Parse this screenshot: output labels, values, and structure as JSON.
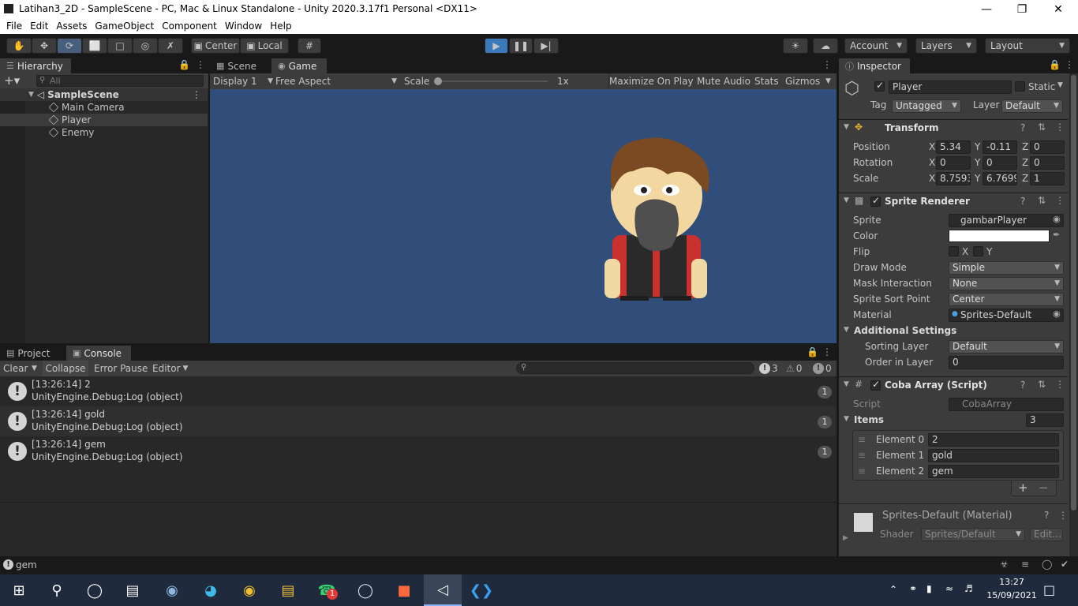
{
  "window": {
    "title": "Latihan3_2D - SampleScene - PC, Mac & Linux Standalone - Unity 2020.3.17f1 Personal <DX11>"
  },
  "menu": [
    "File",
    "Edit",
    "Assets",
    "GameObject",
    "Component",
    "Window",
    "Help"
  ],
  "toolbar": {
    "pivot": "Center",
    "space": "Local",
    "account": "Account",
    "layers": "Layers",
    "layout": "Layout"
  },
  "hierarchy": {
    "tab": "Hierarchy",
    "search_placeholder": "All",
    "scene": "SampleScene",
    "items": [
      "Main Camera",
      "Player",
      "Enemy"
    ]
  },
  "game": {
    "tabs": [
      "Scene",
      "Game"
    ],
    "display": "Display 1",
    "aspect": "Free Aspect",
    "scale_label": "Scale",
    "scale_value": "1x",
    "maximize": "Maximize On Play",
    "mute": "Mute Audio",
    "stats": "Stats",
    "gizmos": "Gizmos",
    "background": "#314d79"
  },
  "console": {
    "tabs": [
      "Project",
      "Console"
    ],
    "clear": "Clear",
    "collapse": "Collapse",
    "error_pause": "Error Pause",
    "editor": "Editor",
    "count_log": "3",
    "count_warn": "0",
    "count_err": "0",
    "logs": [
      {
        "line1": "[13:26:14] 2",
        "line2": "UnityEngine.Debug:Log (object)",
        "count": "1"
      },
      {
        "line1": "[13:26:14] gold",
        "line2": "UnityEngine.Debug:Log (object)",
        "count": "1"
      },
      {
        "line1": "[13:26:14] gem",
        "line2": "UnityEngine.Debug:Log (object)",
        "count": "1"
      }
    ]
  },
  "inspector": {
    "tab": "Inspector",
    "object_name": "Player",
    "static_label": "Static",
    "tag_label": "Tag",
    "tag_value": "Untagged",
    "layer_label": "Layer",
    "layer_value": "Default",
    "transform": {
      "title": "Transform",
      "position": {
        "label": "Position",
        "x": "5.34",
        "y": "-0.11",
        "z": "0"
      },
      "rotation": {
        "label": "Rotation",
        "x": "0",
        "y": "0",
        "z": "0"
      },
      "scale": {
        "label": "Scale",
        "x": "8.7593",
        "y": "6.7699",
        "z": "1"
      }
    },
    "sprite_renderer": {
      "title": "Sprite Renderer",
      "sprite_label": "Sprite",
      "sprite_value": "gambarPlayer",
      "color_label": "Color",
      "flip_label": "Flip",
      "flip_x": "X",
      "flip_y": "Y",
      "draw_mode_label": "Draw Mode",
      "draw_mode_value": "Simple",
      "mask_label": "Mask Interaction",
      "mask_value": "None",
      "sort_point_label": "Sprite Sort Point",
      "sort_point_value": "Center",
      "material_label": "Material",
      "material_value": "Sprites-Default",
      "additional": "Additional Settings",
      "sorting_layer_label": "Sorting Layer",
      "sorting_layer_value": "Default",
      "order_label": "Order in Layer",
      "order_value": "0"
    },
    "script": {
      "title": "Coba Array (Script)",
      "script_label": "Script",
      "script_value": "CobaArray",
      "items_label": "Items",
      "items_count": "3",
      "elements": [
        {
          "label": "Element 0",
          "value": "2"
        },
        {
          "label": "Element 1",
          "value": "gold"
        },
        {
          "label": "Element 2",
          "value": "gem"
        }
      ]
    },
    "material": {
      "title": "Sprites-Default (Material)",
      "shader_label": "Shader",
      "shader_value": "Sprites/Default",
      "edit": "Edit..."
    }
  },
  "status": {
    "message": "gem"
  },
  "taskbar": {
    "time": "13:27",
    "date": "15/09/2021",
    "whatsapp_badge": "1"
  }
}
